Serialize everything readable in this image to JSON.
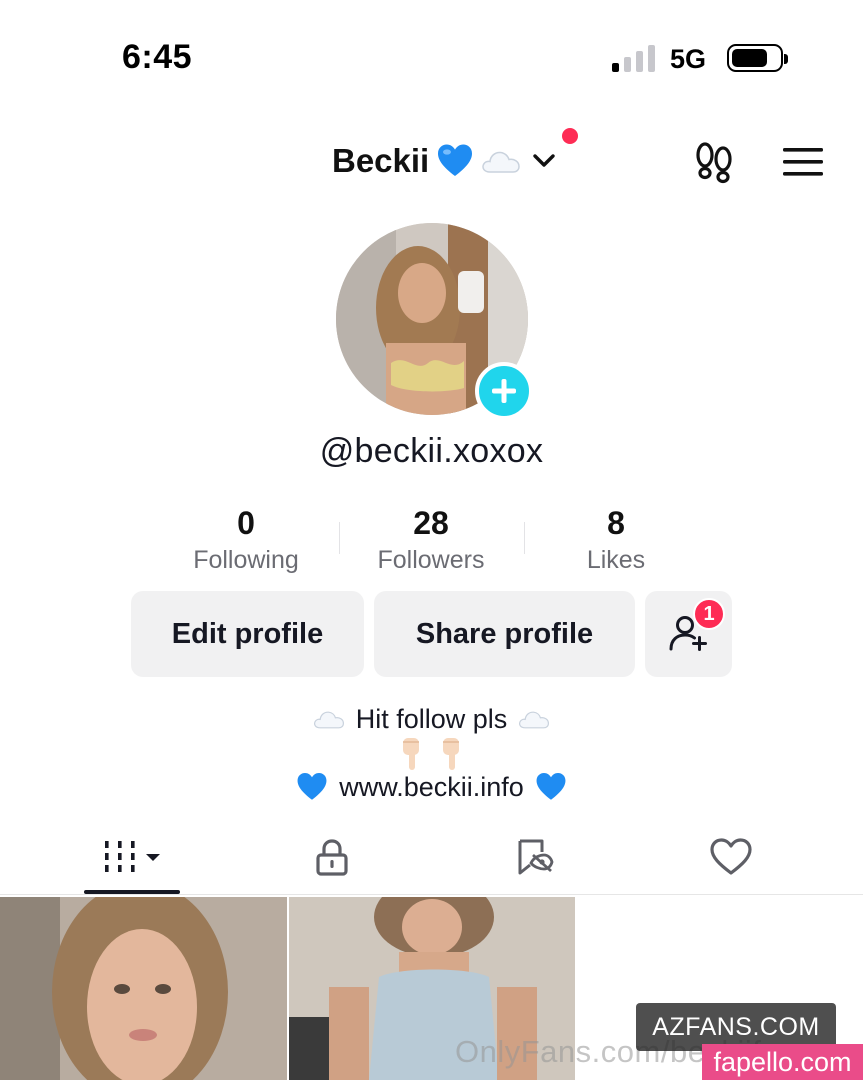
{
  "status_bar": {
    "time": "6:45",
    "network": "5G",
    "signal_bars_active": 1,
    "signal_bars_total": 4,
    "battery_level": 0.76
  },
  "header": {
    "display_name": "Beckii",
    "name_emojis": [
      "blue-heart",
      "cloud"
    ],
    "has_notification_dot": true,
    "icons": [
      "footprint-icon",
      "hamburger-menu-icon"
    ]
  },
  "profile": {
    "username": "@beckii.xoxox",
    "avatar_add_icon": "plus-icon"
  },
  "stats": [
    {
      "value": "0",
      "label": "Following"
    },
    {
      "value": "28",
      "label": "Followers"
    },
    {
      "value": "8",
      "label": "Likes"
    }
  ],
  "actions": {
    "edit_profile": "Edit profile",
    "share_profile": "Share profile",
    "friend_badge_count": "1"
  },
  "bio": {
    "line1": "Hit follow pls",
    "line3": "www.beckii.info"
  },
  "tabs": [
    {
      "name": "videos",
      "icon": "grid-icon",
      "selected": true
    },
    {
      "name": "private",
      "icon": "lock-icon",
      "selected": false
    },
    {
      "name": "saved",
      "icon": "bookmark-hidden-icon",
      "selected": false
    },
    {
      "name": "liked",
      "icon": "heart-icon",
      "selected": false
    }
  ],
  "watermarks": {
    "onlyfans": "OnlyFans.com/beckiif",
    "azfans": "AZFANS.COM",
    "fapello": "fapello.com"
  },
  "colors": {
    "accent_red": "#fe2c55",
    "avatar_plus": "#20d5ec",
    "button_bg": "#f1f1f2",
    "secondary_text": "#6b6c73"
  }
}
